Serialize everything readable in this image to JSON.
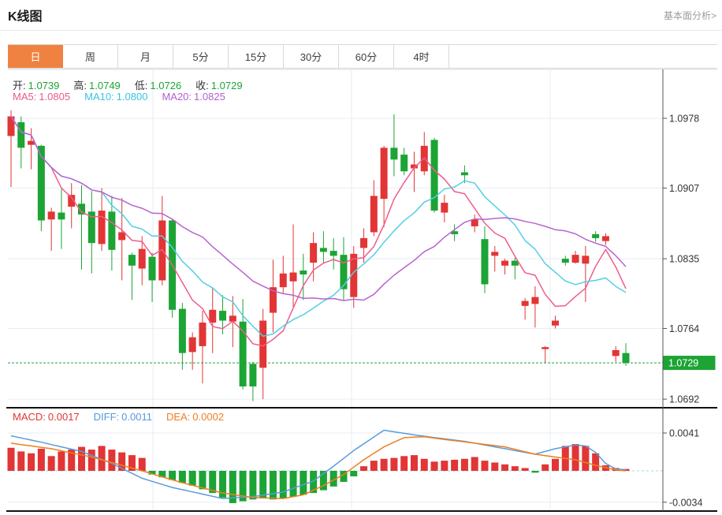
{
  "header": {
    "title": "K线图",
    "link": "基本面分析>"
  },
  "tabs": {
    "active_index": 0,
    "items": [
      "日",
      "周",
      "月",
      "5分",
      "15分",
      "30分",
      "60分",
      "4时"
    ]
  },
  "price_legend": {
    "items": [
      {
        "key": "open",
        "label": "开:",
        "value": "1.0739"
      },
      {
        "key": "high",
        "label": "高:",
        "value": "1.0749"
      },
      {
        "key": "low",
        "label": "低:",
        "value": "1.0726"
      },
      {
        "key": "close",
        "label": "收:",
        "value": "1.0729"
      }
    ]
  },
  "ma_legend": {
    "items": [
      {
        "key": "ma5",
        "label": "MA5:",
        "value": "1.0805",
        "color": "#e85c86"
      },
      {
        "key": "ma10",
        "label": "MA10:",
        "value": "1.0800",
        "color": "#38c4e4"
      },
      {
        "key": "ma20",
        "label": "MA20:",
        "value": "1.0825",
        "color": "#b05fd3"
      }
    ]
  },
  "macd_legend": {
    "items": [
      {
        "key": "macd",
        "label": "MACD:",
        "value": "0.0017",
        "color": "#e23535"
      },
      {
        "key": "diff",
        "label": "DIFF:",
        "value": "0.0011",
        "color": "#5599dd"
      },
      {
        "key": "dea",
        "label": "DEA:",
        "value": "0.0002",
        "color": "#ee7e20"
      }
    ]
  },
  "colors": {
    "up": "#e23535",
    "down": "#1ca435",
    "ma5": "#ee5d8c",
    "ma10": "#53cfe6",
    "ma20": "#b863cd",
    "diff": "#5b9bd9",
    "dea": "#ee7e20",
    "tab_active_bg": "#ef8240",
    "badge_bg": "#1ca435",
    "grid": "#e7edf3",
    "axis_text": "#333333",
    "zero_dash": "#a6d9ee",
    "price_dash": "#1ea23a",
    "panel_border": "#111111",
    "axis_line": "#555555"
  },
  "chart_data": {
    "type": "candlestick",
    "title": "K线图 (日)",
    "legend_position": "top-left",
    "grid": true,
    "price_axis_ticks": [
      1.0978,
      1.0907,
      1.0835,
      1.0764,
      1.0692
    ],
    "current_price": 1.0729,
    "price_range": [
      1.066,
      1.1
    ],
    "macd_axis_ticks": [
      0.0041,
      -0.0034
    ],
    "ma_periods": [
      5,
      10,
      20
    ],
    "candles": [
      [
        1.096,
        1.0986,
        1.0908,
        1.098
      ],
      [
        1.0974,
        1.098,
        1.0927,
        1.0948
      ],
      [
        1.0951,
        1.0968,
        1.0926,
        1.0955
      ],
      [
        1.095,
        1.0951,
        1.0863,
        1.0874
      ],
      [
        1.0875,
        1.0887,
        1.0843,
        1.0883
      ],
      [
        1.0882,
        1.0906,
        1.0845,
        1.0875
      ],
      [
        1.0888,
        1.0912,
        1.0866,
        1.09
      ],
      [
        1.0891,
        1.091,
        1.0824,
        1.088
      ],
      [
        1.0883,
        1.0904,
        1.082,
        1.0851
      ],
      [
        1.085,
        1.0907,
        1.0843,
        1.0884
      ],
      [
        1.0883,
        1.0899,
        1.0823,
        1.0844
      ],
      [
        1.0854,
        1.0897,
        1.0813,
        1.0862
      ],
      [
        1.0839,
        1.0841,
        1.0793,
        1.0828
      ],
      [
        1.0825,
        1.0858,
        1.0808,
        1.0845
      ],
      [
        1.0837,
        1.0841,
        1.0791,
        1.0813
      ],
      [
        1.0813,
        1.0899,
        1.0808,
        1.0874
      ],
      [
        1.0874,
        1.0876,
        1.0775,
        1.0783
      ],
      [
        1.0784,
        1.079,
        1.0722,
        1.0739
      ],
      [
        1.074,
        1.076,
        1.0722,
        1.0755
      ],
      [
        1.0746,
        1.0782,
        1.0708,
        1.077
      ],
      [
        1.077,
        1.0806,
        1.0739,
        1.0783
      ],
      [
        1.0782,
        1.0798,
        1.0758,
        1.0772
      ],
      [
        1.0771,
        1.0797,
        1.0745,
        1.0777
      ],
      [
        1.0771,
        1.0794,
        1.0702,
        1.0705
      ],
      [
        1.0728,
        1.073,
        1.069,
        1.0705
      ],
      [
        1.0724,
        1.0784,
        1.0692,
        1.0772
      ],
      [
        1.078,
        1.0834,
        1.076,
        1.0806
      ],
      [
        1.0806,
        1.0838,
        1.08,
        1.082
      ],
      [
        1.0812,
        1.087,
        1.0786,
        1.0821
      ],
      [
        1.0823,
        1.084,
        1.0793,
        1.0819
      ],
      [
        1.0831,
        1.0862,
        1.0812,
        1.0851
      ],
      [
        1.0846,
        1.0863,
        1.083,
        1.0842
      ],
      [
        1.0843,
        1.0856,
        1.0824,
        1.0838
      ],
      [
        1.0839,
        1.0857,
        1.0793,
        1.0804
      ],
      [
        1.0796,
        1.0848,
        1.0785,
        1.084
      ],
      [
        1.0846,
        1.0866,
        1.0831,
        1.0856
      ],
      [
        1.0862,
        1.0915,
        1.0858,
        1.0899
      ],
      [
        1.0896,
        1.095,
        1.0867,
        1.0948
      ],
      [
        1.0948,
        1.0982,
        1.0919,
        1.0936
      ],
      [
        1.0941,
        1.0948,
        1.092,
        1.0924
      ],
      [
        1.0927,
        1.0944,
        1.0903,
        1.0931
      ],
      [
        1.0924,
        1.0964,
        1.092,
        1.095
      ],
      [
        1.0956,
        1.0958,
        1.0882,
        1.0884
      ],
      [
        1.0882,
        1.09,
        1.0872,
        1.0892
      ],
      [
        1.0863,
        1.087,
        1.0853,
        1.086
      ],
      [
        1.0923,
        1.093,
        1.0912,
        1.092
      ],
      [
        1.0868,
        1.088,
        1.0862,
        1.0875
      ],
      [
        1.0855,
        1.0868,
        1.08,
        1.0809
      ],
      [
        1.0838,
        1.0848,
        1.0822,
        1.0842
      ],
      [
        1.0828,
        1.0835,
        1.0819,
        1.0833
      ],
      [
        1.0833,
        1.0836,
        1.0814,
        1.0828
      ],
      [
        1.0787,
        1.0795,
        1.0773,
        1.0792
      ],
      [
        1.0789,
        1.0807,
        1.0765,
        1.0796
      ],
      [
        1.0743,
        1.0746,
        1.0729,
        1.0745
      ],
      [
        1.0767,
        1.0777,
        1.0764,
        1.0772
      ],
      [
        1.0835,
        1.0838,
        1.0828,
        1.0831
      ],
      [
        1.0831,
        1.0843,
        1.083,
        1.0839
      ],
      [
        1.083,
        1.0848,
        1.0791,
        1.0838
      ],
      [
        1.086,
        1.0863,
        1.0852,
        1.0856
      ],
      [
        1.0853,
        1.0861,
        1.0849,
        1.0858
      ],
      [
        1.0736,
        1.0746,
        1.073,
        1.0742
      ],
      [
        1.0739,
        1.0749,
        1.0726,
        1.0729
      ]
    ],
    "macd_hist": [
      0.0025,
      0.0021,
      0.0019,
      0.0024,
      0.0016,
      0.0021,
      0.0023,
      0.0026,
      0.0023,
      0.0027,
      0.0023,
      0.002,
      0.0017,
      0.0014,
      -0.0004,
      -0.0007,
      -0.001,
      -0.0013,
      -0.0016,
      -0.002,
      -0.0024,
      -0.0029,
      -0.0035,
      -0.0033,
      -0.0031,
      -0.003,
      -0.0031,
      -0.003,
      -0.0028,
      -0.0026,
      -0.0024,
      -0.0021,
      -0.0017,
      -0.0012,
      -0.0006,
      0.0005,
      0.0011,
      0.0013,
      0.0014,
      0.0016,
      0.0017,
      0.0013,
      0.001,
      0.0011,
      0.0012,
      0.0013,
      0.0015,
      0.0011,
      0.0009,
      0.0007,
      0.0005,
      0.0003,
      -0.0002,
      0.0007,
      0.0013,
      0.0027,
      0.0029,
      0.0027,
      0.0019,
      0.0006,
      0.0003,
      0.0002
    ],
    "diff_line": [
      [
        0,
        0.0038
      ],
      [
        3,
        0.0031
      ],
      [
        7,
        0.0021
      ],
      [
        10,
        0.0008
      ],
      [
        13,
        -0.0008
      ],
      [
        16,
        -0.0018
      ],
      [
        21,
        -0.003
      ],
      [
        24,
        -0.0028
      ],
      [
        27,
        -0.0023
      ],
      [
        30,
        -0.0011
      ],
      [
        32,
        0.0005
      ],
      [
        34,
        0.0022
      ],
      [
        37,
        0.0044
      ],
      [
        40,
        0.0039
      ],
      [
        42,
        0.0036
      ],
      [
        45,
        0.0032
      ],
      [
        47,
        0.0028
      ],
      [
        49,
        0.0024
      ],
      [
        51,
        0.002
      ],
      [
        52,
        0.0018
      ],
      [
        54,
        0.0024
      ],
      [
        56,
        0.0028
      ],
      [
        57,
        0.0027
      ],
      [
        58,
        0.002
      ],
      [
        59,
        0.0008
      ],
      [
        60,
        0.0002
      ],
      [
        61,
        0.0001
      ]
    ],
    "dea_line": [
      [
        0,
        0.003
      ],
      [
        4,
        0.0024
      ],
      [
        8,
        0.0015
      ],
      [
        11,
        0.0006
      ],
      [
        13,
        0.0
      ],
      [
        17,
        -0.0013
      ],
      [
        21,
        -0.0024
      ],
      [
        24,
        -0.0029
      ],
      [
        27,
        -0.003
      ],
      [
        29,
        -0.0026
      ],
      [
        31,
        -0.0016
      ],
      [
        33,
        -0.0004
      ],
      [
        35,
        0.0012
      ],
      [
        37,
        0.0026
      ],
      [
        39,
        0.0036
      ],
      [
        41,
        0.0037
      ],
      [
        43,
        0.0034
      ],
      [
        46,
        0.003
      ],
      [
        49,
        0.0026
      ],
      [
        52,
        0.0018
      ],
      [
        54,
        0.0015
      ],
      [
        56,
        0.0012
      ],
      [
        58,
        0.0006
      ],
      [
        60,
        0.0001
      ],
      [
        61,
        0.0
      ]
    ]
  }
}
